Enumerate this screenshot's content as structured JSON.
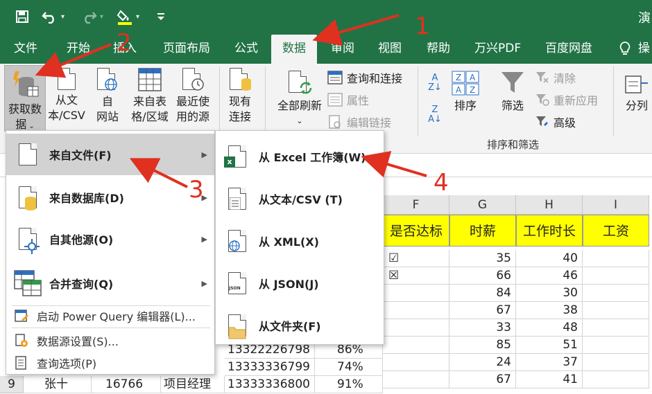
{
  "window": {
    "title": "演"
  },
  "tabs": [
    {
      "label": "文件"
    },
    {
      "label": "开始"
    },
    {
      "label": "插入"
    },
    {
      "label": "页面布局"
    },
    {
      "label": "公式"
    },
    {
      "label": "数据"
    },
    {
      "label": "审阅"
    },
    {
      "label": "视图"
    },
    {
      "label": "帮助"
    },
    {
      "label": "万兴PDF"
    },
    {
      "label": "百度网盘"
    },
    {
      "label": "操"
    }
  ],
  "ribbon": {
    "get_data": {
      "line1": "获取数",
      "line2": "据"
    },
    "from_text": {
      "line1": "从文",
      "line2": "本/CSV"
    },
    "from_web": {
      "line1": "自",
      "line2": "网站"
    },
    "from_table": {
      "line1": "来自表",
      "line2": "格/区域"
    },
    "recent": {
      "line1": "最近使",
      "line2": "用的源"
    },
    "existing": {
      "line1": "现有",
      "line2": "连接"
    },
    "refresh_all": {
      "label": "全部刷新"
    },
    "queries": {
      "label": "查询和连接"
    },
    "properties": {
      "label": "属性"
    },
    "edit_links": {
      "label": "编辑链接"
    },
    "sort": {
      "label": "排序"
    },
    "filter": {
      "label": "筛选"
    },
    "clear": {
      "label": "清除"
    },
    "reapply": {
      "label": "重新应用"
    },
    "advanced": {
      "label": "高级"
    },
    "sort_filter_group": "排序和筛选",
    "split": {
      "label": "分列"
    }
  },
  "menu_main": {
    "items": [
      {
        "label": "来自文件(F)",
        "key": "F"
      },
      {
        "label": "来自数据库(D)",
        "key": "D"
      },
      {
        "label": "自其他源(O)",
        "key": "O"
      },
      {
        "label": "合并查询(Q)",
        "key": "Q"
      }
    ],
    "small_items": [
      {
        "label": "启动 Power Query 编辑器(L)..."
      },
      {
        "label": "数据源设置(S)..."
      },
      {
        "label": "查询选项(P)"
      }
    ]
  },
  "menu_file": {
    "items": [
      {
        "label": "从 Excel 工作簿(W)"
      },
      {
        "label": "从文本/CSV (T)"
      },
      {
        "label": "从 XML(X)"
      },
      {
        "label": "从 JSON(J)"
      },
      {
        "label": "从文件夹(F)"
      }
    ]
  },
  "sheet": {
    "columns": [
      "F",
      "G",
      "H",
      "I"
    ],
    "headers": [
      "是否达标",
      "时薪",
      "工作时长",
      "工资"
    ],
    "rows": [
      {
        "f": "☑",
        "g": "35",
        "h": "40"
      },
      {
        "f": "☒",
        "g": "66",
        "h": "46"
      },
      {
        "f": "",
        "g": "84",
        "h": "30"
      },
      {
        "f": "",
        "g": "67",
        "h": "38"
      },
      {
        "f": "",
        "g": "33",
        "h": "48"
      },
      {
        "f": "",
        "g": "85",
        "h": "51"
      },
      {
        "f": "",
        "g": "24",
        "h": "37"
      },
      {
        "f": "",
        "g": "67",
        "h": "41"
      }
    ],
    "visible_left": [
      {
        "phone": "13322226798",
        "pct": "86%"
      },
      {
        "phone": "13333336799",
        "pct": "74%"
      }
    ],
    "last_row": {
      "rownum": "9",
      "name": "张十",
      "id": "16766",
      "title": "项目经理",
      "phone": "13333336800",
      "pct": "91%"
    }
  },
  "annotations": {
    "n1": "1",
    "n2": "2",
    "n3": "3",
    "n4": "4"
  },
  "colors": {
    "excel_green": "#217346",
    "header_yellow": "#ffff00",
    "annotation_red": "#e03020"
  }
}
